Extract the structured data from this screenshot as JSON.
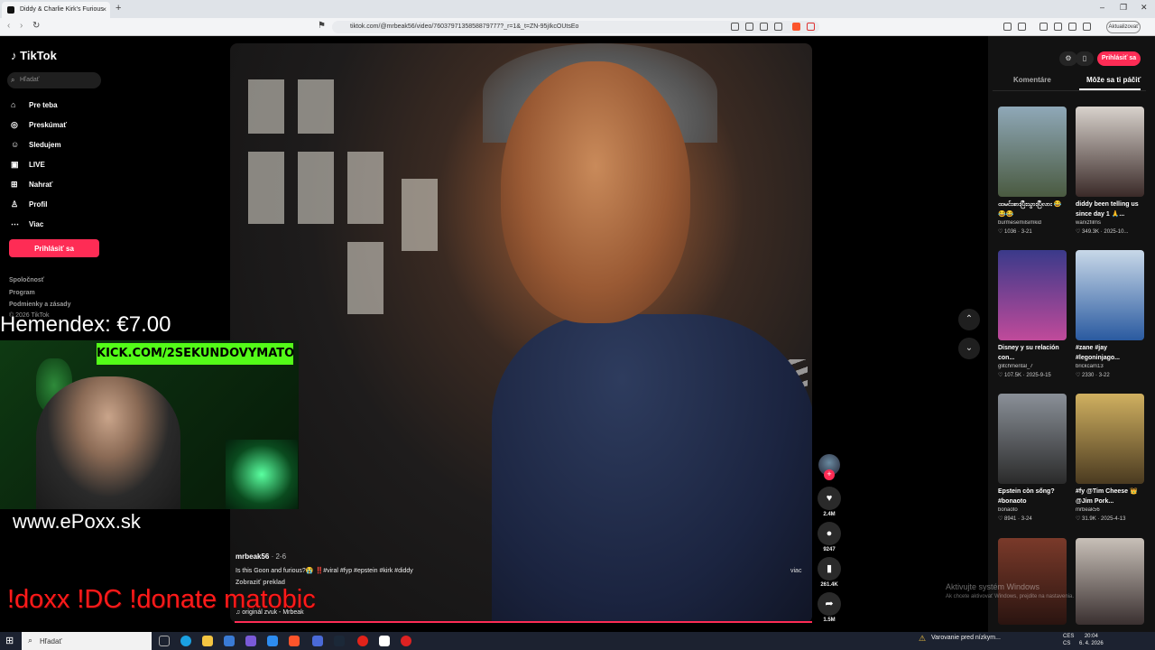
{
  "browser": {
    "tab_title": "Diddy & Charlie Kirk's Furious",
    "tab_close": "×",
    "new_tab": "+",
    "url": "tiktok.com/@mrbeak56/video/7603797135858879777?_r=1&_t=ZN-95jIkcOUtsEo",
    "update_label": "Aktualizovať",
    "win_min": "–",
    "win_max": "❐",
    "win_close": "✕"
  },
  "nav": {
    "logo": "TikTok",
    "search_placeholder": "Hľadať",
    "items": [
      {
        "label": "Pre teba",
        "icon": "home-icon"
      },
      {
        "label": "Preskúmať",
        "icon": "compass-icon"
      },
      {
        "label": "Sledujem",
        "icon": "following-icon"
      },
      {
        "label": "LIVE",
        "icon": "live-icon"
      },
      {
        "label": "Nahrať",
        "icon": "upload-icon"
      },
      {
        "label": "Profil",
        "icon": "profile-icon"
      },
      {
        "label": "Viac",
        "icon": "more-icon"
      }
    ],
    "login": "Prihlásiť sa",
    "footer": [
      "Spoločnosť",
      "Program",
      "Podmienky a zásady",
      "© 2026 TikTok"
    ]
  },
  "video": {
    "author": "mrbeak56",
    "date": "· 2-6",
    "description": "Is this Goon and furious?😭 ‼️#viral #fyp #epstein #kirk #diddy",
    "translate": "Zobraziť preklad",
    "sound": "♫ originál zvuk - Mrbeak",
    "side_label": "viac",
    "likes": "2.4M",
    "comments": "9247",
    "saves": "261.4K",
    "shares": "1.5M"
  },
  "right_panel": {
    "tab_comments": "Komentáre",
    "tab_suggested": "Môže sa ti páčiť",
    "login": "Prihlásiť sa",
    "videos": [
      {
        "title": "ထမင်းစားပြီးသွားပြီလား 😂😂😂",
        "user": "burmesemilsimkid",
        "meta": "♡ 1036 · 3-21",
        "color1": "#8fa8b8",
        "color2": "#4a5a40"
      },
      {
        "title": "diddy been telling us since day 1 🙏...",
        "user": "warxzfilms",
        "meta": "♡ 349.3K · 2025-10...",
        "color1": "#d8d2cc",
        "color2": "#3a2a28"
      },
      {
        "title": "Disney y su relación con...",
        "user": "glitchmental_7",
        "meta": "♡ 107.5K · 2025-9-15",
        "color1": "#3a3a8a",
        "color2": "#c04a9a"
      },
      {
        "title": "#zane #jay #legoninjago...",
        "user": "brickcam13",
        "meta": "♡ 2330 · 3-22",
        "color1": "#c8d8e8",
        "color2": "#2a5aa0"
      },
      {
        "title": "Epstein còn sống? #bonaoto",
        "user": "bonaoto",
        "meta": "♡ 8941 · 3-24",
        "color1": "#8a9098",
        "color2": "#2a2a2a"
      },
      {
        "title": "#fy @Tim Cheese 👑 @Jim Pork...",
        "user": "mrbeak56",
        "meta": "♡ 31.9K · 2025-4-13",
        "color1": "#d0b060",
        "color2": "#4a3a20"
      },
      {
        "title": "",
        "user": "",
        "meta": "",
        "color1": "#7a3a2a",
        "color2": "#2a1410"
      },
      {
        "title": "",
        "user": "",
        "meta": "",
        "color1": "#c8c0b8",
        "color2": "#3a3030"
      }
    ]
  },
  "windows_activation": {
    "title": "Aktivujte systém Windows",
    "subtitle": "Ak chcete aktivovať Windows, prejdite na nastavenia."
  },
  "stream_overlay": {
    "donation": "Hemendex: €7.00",
    "kick": "KICK.COM/2SEKUNDOVYMATO",
    "site": "www.ePoxx.sk",
    "commands": "!doxx  !DC  !donate  matobic"
  },
  "taskbar": {
    "search": "Hľadať",
    "warning": "Varovanie pred nízkym...",
    "lang": "CES\nCS",
    "time": "20:04",
    "date": "6. 4. 2026"
  },
  "colors": {
    "accent": "#fe2c55",
    "kick_green": "#53fc18",
    "command_red": "#ff1a1a"
  }
}
